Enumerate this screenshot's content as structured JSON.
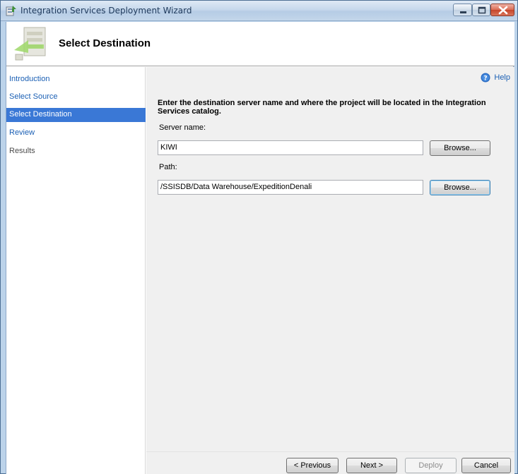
{
  "window": {
    "title": "Integration Services Deployment Wizard"
  },
  "header": {
    "title": "Select Destination"
  },
  "nav": {
    "items": [
      {
        "label": "Introduction",
        "state": "link"
      },
      {
        "label": "Select Source",
        "state": "link"
      },
      {
        "label": "Select Destination",
        "state": "selected"
      },
      {
        "label": "Review",
        "state": "link"
      },
      {
        "label": "Results",
        "state": "disabled"
      }
    ]
  },
  "main": {
    "help_label": "Help",
    "instruction": "Enter the destination server name and where the project will be located in the Integration Services catalog.",
    "server_label": "Server name:",
    "server_value": "KIWI",
    "path_label": "Path:",
    "path_value": "/SSISDB/Data Warehouse/ExpeditionDenali",
    "browse_label": "Browse..."
  },
  "footer": {
    "previous_label": "< Previous",
    "next_label": "Next >",
    "deploy_label": "Deploy",
    "cancel_label": "Cancel"
  },
  "colors": {
    "selected_nav": "#3a78d6",
    "link": "#1a5fb4",
    "title_text": "#1e395b"
  }
}
